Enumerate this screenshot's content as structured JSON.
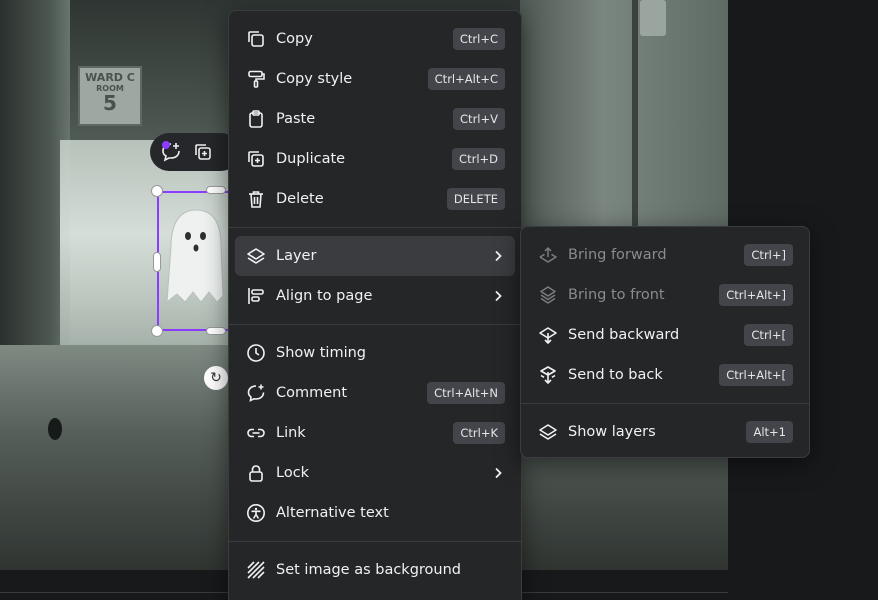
{
  "canvas": {
    "sign": {
      "line1": "WARD C",
      "line2": "ROOM",
      "line3": "5"
    }
  },
  "menu": {
    "items": [
      {
        "label": "Copy",
        "shortcut": "Ctrl+C",
        "icon": "copy-icon"
      },
      {
        "label": "Copy style",
        "shortcut": "Ctrl+Alt+C",
        "icon": "paint-roller-icon"
      },
      {
        "label": "Paste",
        "shortcut": "Ctrl+V",
        "icon": "clipboard-icon"
      },
      {
        "label": "Duplicate",
        "shortcut": "Ctrl+D",
        "icon": "duplicate-icon"
      },
      {
        "label": "Delete",
        "shortcut": "DELETE",
        "icon": "trash-icon"
      },
      {
        "label": "Layer",
        "icon": "layers-icon",
        "submenu": true
      },
      {
        "label": "Align to page",
        "icon": "align-icon",
        "submenu": true
      },
      {
        "label": "Show timing",
        "icon": "clock-icon"
      },
      {
        "label": "Comment",
        "shortcut": "Ctrl+Alt+N",
        "icon": "comment-icon"
      },
      {
        "label": "Link",
        "shortcut": "Ctrl+K",
        "icon": "link-icon"
      },
      {
        "label": "Lock",
        "icon": "lock-icon",
        "submenu": true
      },
      {
        "label": "Alternative text",
        "icon": "accessibility-icon"
      },
      {
        "label": "Set image as background",
        "icon": "background-icon"
      }
    ]
  },
  "submenu": {
    "items": [
      {
        "label": "Bring forward",
        "shortcut": "Ctrl+]",
        "icon": "bring-forward-icon"
      },
      {
        "label": "Bring to front",
        "shortcut": "Ctrl+Alt+]",
        "icon": "bring-to-front-icon"
      },
      {
        "label": "Send backward",
        "shortcut": "Ctrl+[",
        "icon": "send-backward-icon"
      },
      {
        "label": "Send to back",
        "shortcut": "Ctrl+Alt+[",
        "icon": "send-to-back-icon"
      },
      {
        "label": "Show layers",
        "shortcut": "Alt+1",
        "icon": "layers-icon"
      }
    ]
  },
  "colors": {
    "accent": "#8b3dff",
    "menu_bg": "#252628",
    "highlight": "#3b3c40",
    "text": "#f1f1f2",
    "disabled_text": "#8a8b8f"
  }
}
